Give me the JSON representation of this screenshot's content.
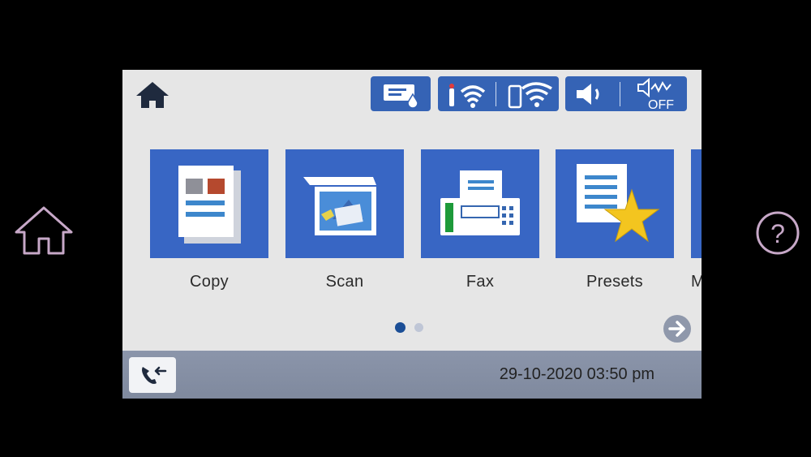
{
  "main": {
    "tiles": [
      {
        "label": "Copy",
        "icon": "copy-icon"
      },
      {
        "label": "Scan",
        "icon": "scan-icon"
      },
      {
        "label": "Fax",
        "icon": "fax-icon"
      },
      {
        "label": "Presets",
        "icon": "presets-icon"
      },
      {
        "label": "M",
        "icon": "more-icon"
      }
    ],
    "page_indicator": {
      "current": 1,
      "total": 2
    }
  },
  "status": {
    "icons": [
      "ink-status-icon",
      "wifi-icon",
      "wifi-direct-icon",
      "volume-icon",
      "quiet-mode-off-icon"
    ],
    "quiet_mode_label": "OFF"
  },
  "footer": {
    "datetime": "29-10-2020 03:50 pm",
    "fax_log_icon": "fax-log-icon"
  },
  "hardware": {
    "home_icon": "home-icon",
    "help_icon": "help-icon",
    "help_label": "?"
  },
  "colors": {
    "tile_blue": "#3866c4",
    "status_blue": "#3563b5",
    "screen_bg": "#e6e6e6",
    "star": "#f3c51f",
    "fax_green": "#1d9a3a"
  }
}
